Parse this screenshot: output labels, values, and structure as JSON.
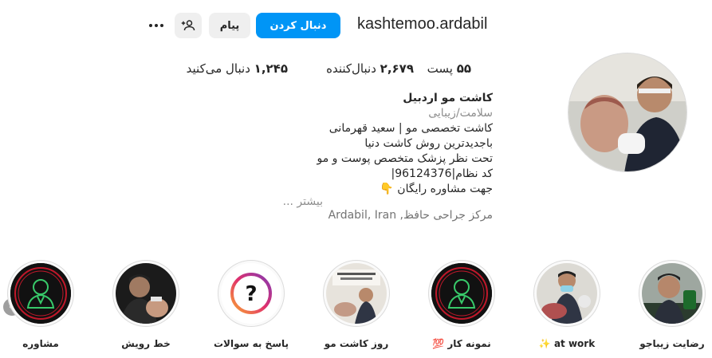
{
  "profile": {
    "username": "kashtemoo.ardabil",
    "follow_label": "دنبال کردن",
    "message_label": "پیام",
    "more_icon": "more-horizontal-icon",
    "add_user_icon": "person-plus-icon"
  },
  "stats": {
    "posts": {
      "value": "۵۵",
      "label": "پست"
    },
    "followers": {
      "value": "۲,۶۷۹",
      "label": "دنبال‌کننده"
    },
    "following": {
      "value": "۱,۲۴۵",
      "label": "دنبال می‌کنید"
    }
  },
  "bio": {
    "name": "کاشت مو اردبیل",
    "category": "سلامت/زیبایی",
    "lines": [
      "کاشت تخصصی مو | سعید قهرمانی",
      "باجدیدترین روش کاشت دنیا",
      "تحت نظر پزشک متخصص پوست و مو",
      "کد نظام|96124376|",
      "جهت مشاوره رایگان 👇"
    ],
    "more": "بیشتر ...",
    "location": "مرکز جراحی حافظ, Ardabil, Iran"
  },
  "highlights": [
    {
      "label": "رضایت زیباجو"
    },
    {
      "label": "at work ✨"
    },
    {
      "label": "نمونه کار 💯"
    },
    {
      "label": "روز کاشت مو"
    },
    {
      "label": "پاسخ به سوالات"
    },
    {
      "label": "خط رویش"
    },
    {
      "label": "مشاوره"
    }
  ],
  "colors": {
    "primary": "#0095f6",
    "secondary_button": "#efefef",
    "text": "#262626",
    "muted": "#8e8e8e"
  }
}
